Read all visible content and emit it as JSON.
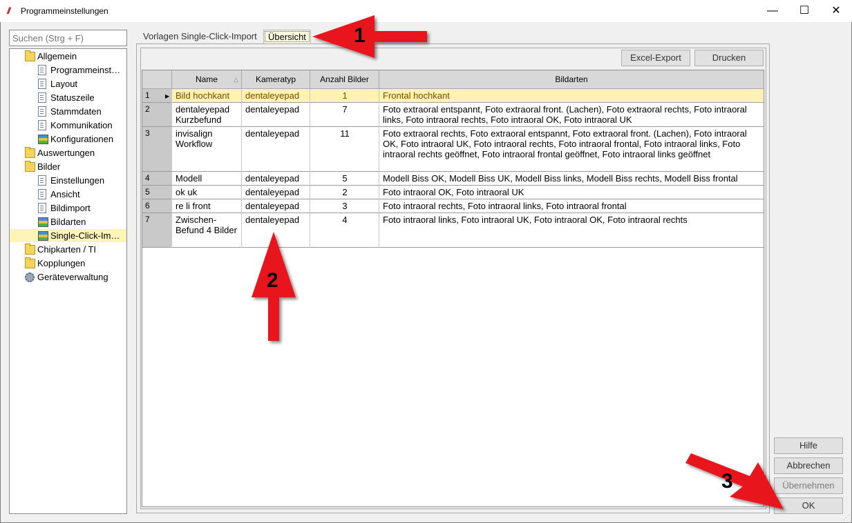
{
  "window": {
    "title": "Programmeinstellungen"
  },
  "search": {
    "placeholder": "Suchen (Strg + F)"
  },
  "tree": [
    {
      "label": "Allgemein",
      "icon": "folder-icon",
      "level": 0
    },
    {
      "label": "Programmeinst…",
      "icon": "page-icon",
      "level": 1
    },
    {
      "label": "Layout",
      "icon": "page-icon",
      "level": 1
    },
    {
      "label": "Statuszeile",
      "icon": "page-icon",
      "level": 1
    },
    {
      "label": "Stammdaten",
      "icon": "page-icon",
      "level": 1
    },
    {
      "label": "Kommunikation",
      "icon": "page-icon",
      "level": 1
    },
    {
      "label": "Konfigurationen",
      "icon": "stack-icon",
      "level": 1
    },
    {
      "label": "Auswertungen",
      "icon": "folder-icon",
      "level": 0
    },
    {
      "label": "Bilder",
      "icon": "folder-icon",
      "level": 0
    },
    {
      "label": "Einstellungen",
      "icon": "page-icon",
      "level": 1
    },
    {
      "label": "Ansicht",
      "icon": "page-icon",
      "level": 1
    },
    {
      "label": "Bildimport",
      "icon": "page-icon",
      "level": 1
    },
    {
      "label": "Bildarten",
      "icon": "stack-icon",
      "level": 1
    },
    {
      "label": "Single-Click-Im…",
      "icon": "stack-icon",
      "level": 1,
      "selected": true
    },
    {
      "label": "Chipkarten / TI",
      "icon": "folder-icon",
      "level": 0
    },
    {
      "label": "Kopplungen",
      "icon": "folder-icon",
      "level": 0
    },
    {
      "label": "Geräteverwaltung",
      "icon": "gear-icon",
      "level": 0
    }
  ],
  "tabs": {
    "vorlagen": "Vorlagen Single-Click-Import",
    "uebersicht": "Übersicht"
  },
  "toolbar": {
    "excel_export": "Excel-Export",
    "drucken": "Drucken"
  },
  "table": {
    "headers": {
      "name": "Name",
      "kameratyp": "Kameratyp",
      "anzahl": "Anzahl Bilder",
      "bildarten": "Bildarten"
    },
    "rows": [
      {
        "nr": "1",
        "name": "Bild hochkant",
        "kameratyp": "dentaleyepad",
        "anzahl": "1",
        "bildarten": "Frontal hochkant"
      },
      {
        "nr": "2",
        "name": "dentaleyepad Kurzbefund",
        "kameratyp": "dentaleyepad",
        "anzahl": "7",
        "bildarten": "Foto extraoral entspannt, Foto extraoral front. (Lachen), Foto extraoral rechts, Foto intraoral links, Foto intraoral rechts, Foto intraoral OK, Foto intraoral UK"
      },
      {
        "nr": "3",
        "name": "invisalign Workflow",
        "kameratyp": "dentaleyepad",
        "anzahl": "11",
        "bildarten": "Foto extraoral rechts, Foto extraoral entspannt, Foto extraoral front. (Lachen), Foto intraoral OK, Foto intraoral UK, Foto intraoral rechts, Foto intraoral frontal, Foto intraoral links, Foto intraoral rechts geöffnet, Foto intraoral frontal geöffnet, Foto intraoral links geöffnet"
      },
      {
        "nr": "4",
        "name": "Modell",
        "kameratyp": "dentaleyepad",
        "anzahl": "5",
        "bildarten": "Modell Biss OK, Modell Biss UK, Modell Biss links, Modell Biss rechts, Modell Biss frontal"
      },
      {
        "nr": "5",
        "name": "ok uk",
        "kameratyp": "dentaleyepad",
        "anzahl": "2",
        "bildarten": "Foto intraoral OK, Foto intraoral UK"
      },
      {
        "nr": "6",
        "name": "re li front",
        "kameratyp": "dentaleyepad",
        "anzahl": "3",
        "bildarten": "Foto intraoral rechts, Foto intraoral links, Foto intraoral frontal"
      },
      {
        "nr": "7",
        "name": "Zwischen-Befund 4 Bilder",
        "kameratyp": "dentaleyepad",
        "anzahl": "4",
        "bildarten": "Foto intraoral links, Foto intraoral UK, Foto intraoral OK, Foto intraoral rechts"
      }
    ]
  },
  "buttons": {
    "hilfe": "Hilfe",
    "abbrechen": "Abbrechen",
    "uebernehmen": "Übernehmen",
    "ok": "OK"
  },
  "annotations": {
    "one": "1",
    "two": "2",
    "three": "3"
  },
  "colors": {
    "arrow": "#e8121a",
    "selection": "#fff1b8",
    "brand": "#c0262d"
  }
}
